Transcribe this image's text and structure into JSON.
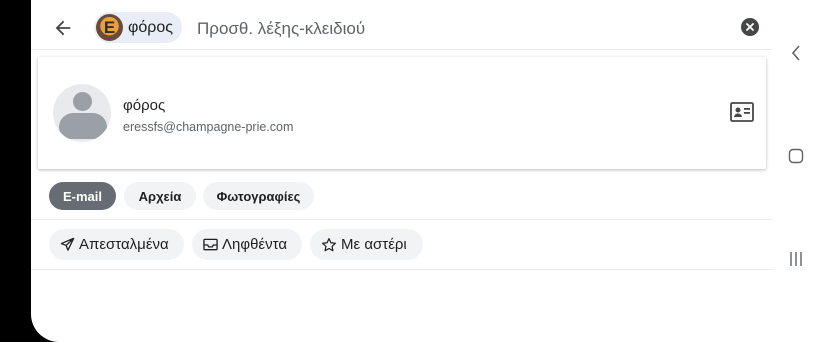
{
  "search": {
    "contact_chip": {
      "avatar_letter": "E",
      "label": "φόρος"
    },
    "placeholder": "Προσθ. λέξης-κλειδιού",
    "value": ""
  },
  "contact": {
    "name": "φόρος",
    "email": "eressfs@champagne-prie.com"
  },
  "filters_row1": [
    "E-mail",
    "Αρχεία",
    "Φωτογραφίες"
  ],
  "filters_row2": [
    "Απεσταλμένα",
    "Ληφθέντα",
    "Με αστέρι"
  ],
  "colors": {
    "active_chip": "#676c72",
    "chip_bg": "#f1f3f4",
    "contact_chip_bg": "#e9eef6"
  },
  "icons": {
    "back": "arrow-left-icon",
    "clear": "close-circle-icon",
    "contact_card": "contact-card-icon",
    "sent": "send-icon",
    "received": "inbox-icon",
    "starred": "star-icon",
    "nav_back": "chevron-left-icon",
    "nav_home": "home-square-icon",
    "nav_recents": "recents-icon"
  }
}
